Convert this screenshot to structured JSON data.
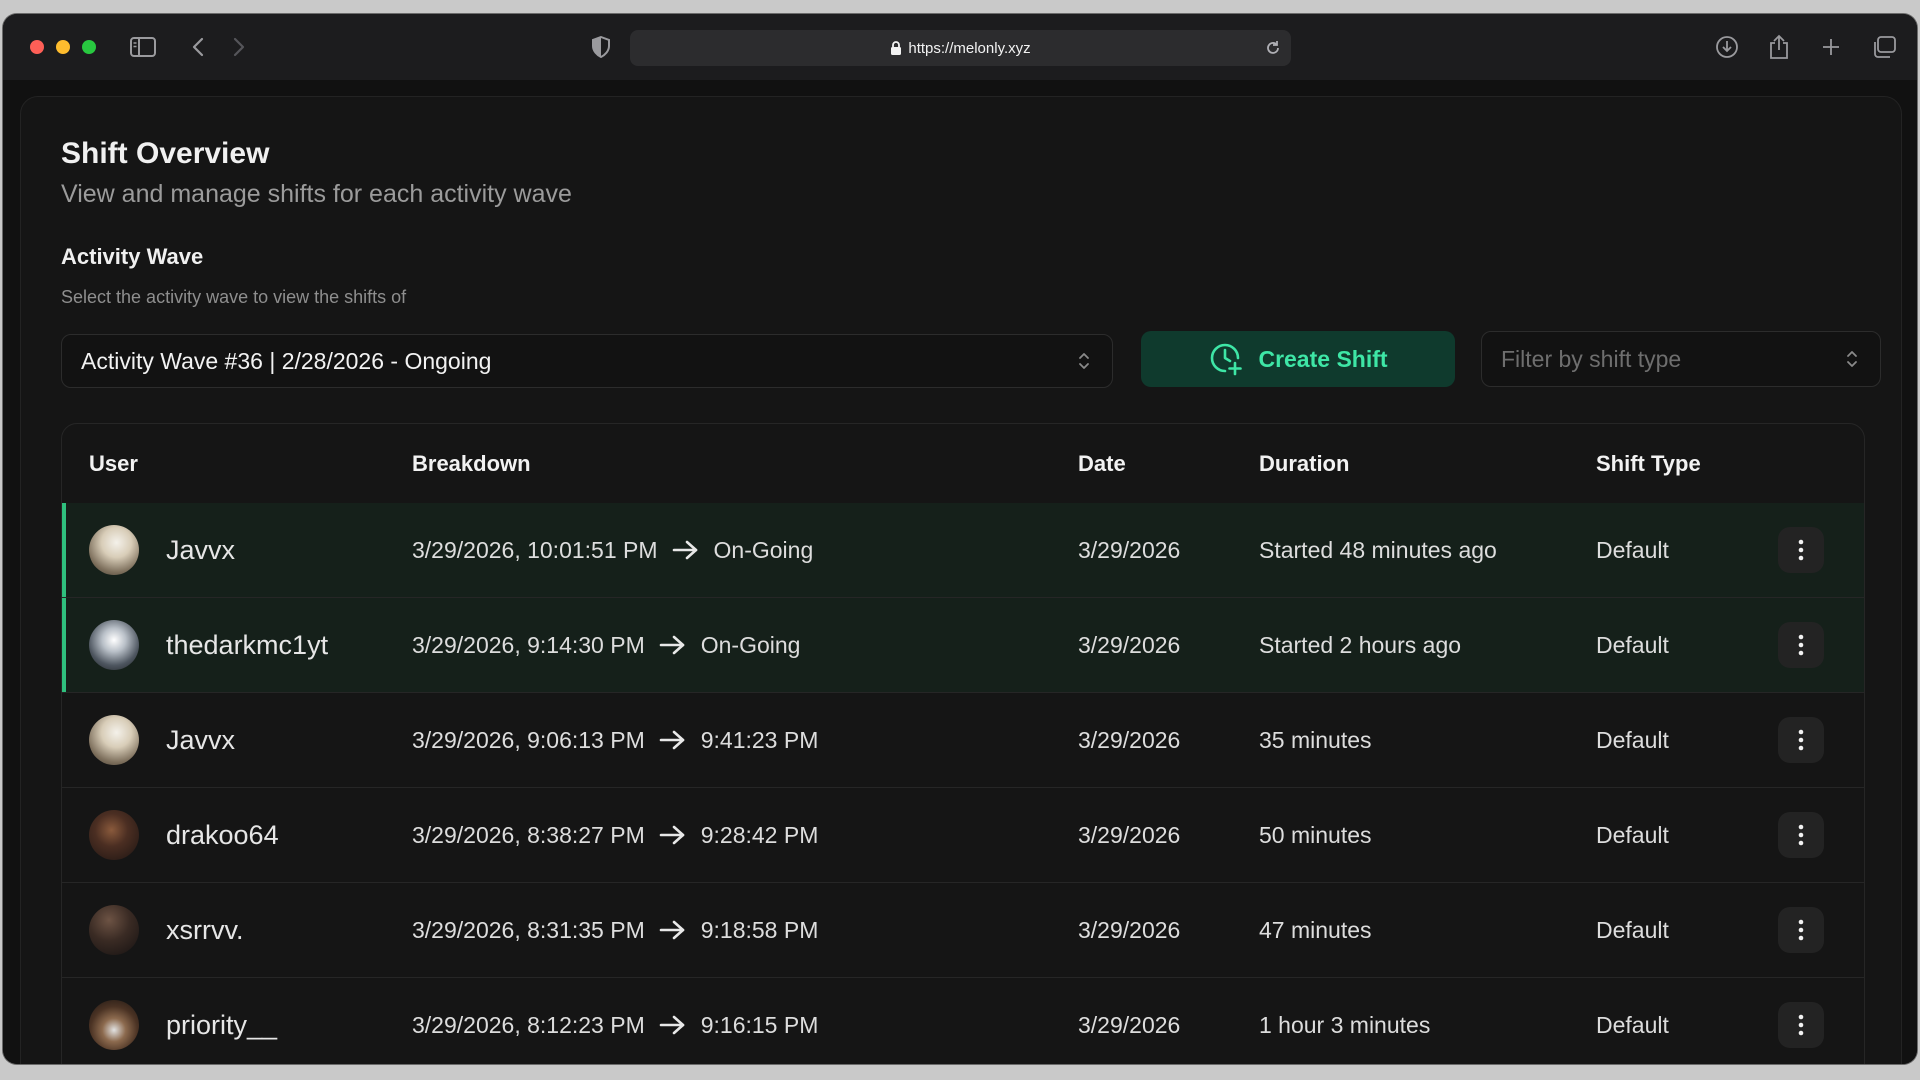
{
  "browser": {
    "url": "https://melonly.xyz"
  },
  "page": {
    "title": "Shift Overview",
    "subtitle": "View and manage shifts for each activity wave"
  },
  "activity_wave": {
    "label": "Activity Wave",
    "hint": "Select the activity wave to view the shifts of",
    "selected": "Activity Wave #36 | 2/28/2026 - Ongoing"
  },
  "actions": {
    "create_shift_label": "Create Shift",
    "filter_placeholder": "Filter by shift type"
  },
  "table": {
    "headers": {
      "user": "User",
      "breakdown": "Breakdown",
      "date": "Date",
      "duration": "Duration",
      "shift_type": "Shift Type"
    },
    "rows": [
      {
        "user": "Javvx",
        "start": "3/29/2026, 10:01:51 PM",
        "end": "On-Going",
        "date": "3/29/2026",
        "duration": "Started 48 minutes ago",
        "shift_type": "Default"
      },
      {
        "user": "thedarkmc1yt",
        "start": "3/29/2026, 9:14:30 PM",
        "end": "On-Going",
        "date": "3/29/2026",
        "duration": "Started 2 hours ago",
        "shift_type": "Default"
      },
      {
        "user": "Javvx",
        "start": "3/29/2026, 9:06:13 PM",
        "end": "9:41:23 PM",
        "date": "3/29/2026",
        "duration": "35 minutes",
        "shift_type": "Default"
      },
      {
        "user": "drakoo64",
        "start": "3/29/2026, 8:38:27 PM",
        "end": "9:28:42 PM",
        "date": "3/29/2026",
        "duration": "50 minutes",
        "shift_type": "Default"
      },
      {
        "user": "xsrrvv.",
        "start": "3/29/2026, 8:31:35 PM",
        "end": "9:18:58 PM",
        "date": "3/29/2026",
        "duration": "47 minutes",
        "shift_type": "Default"
      },
      {
        "user": "priority__",
        "start": "3/29/2026, 8:12:23 PM",
        "end": "9:16:15 PM",
        "date": "3/29/2026",
        "duration": "1 hour 3 minutes",
        "shift_type": "Default"
      }
    ]
  },
  "colors": {
    "accent": "#3ee6a6",
    "accent_bg": "#0f3a2d",
    "ongoing_bar": "#2fc07e"
  }
}
